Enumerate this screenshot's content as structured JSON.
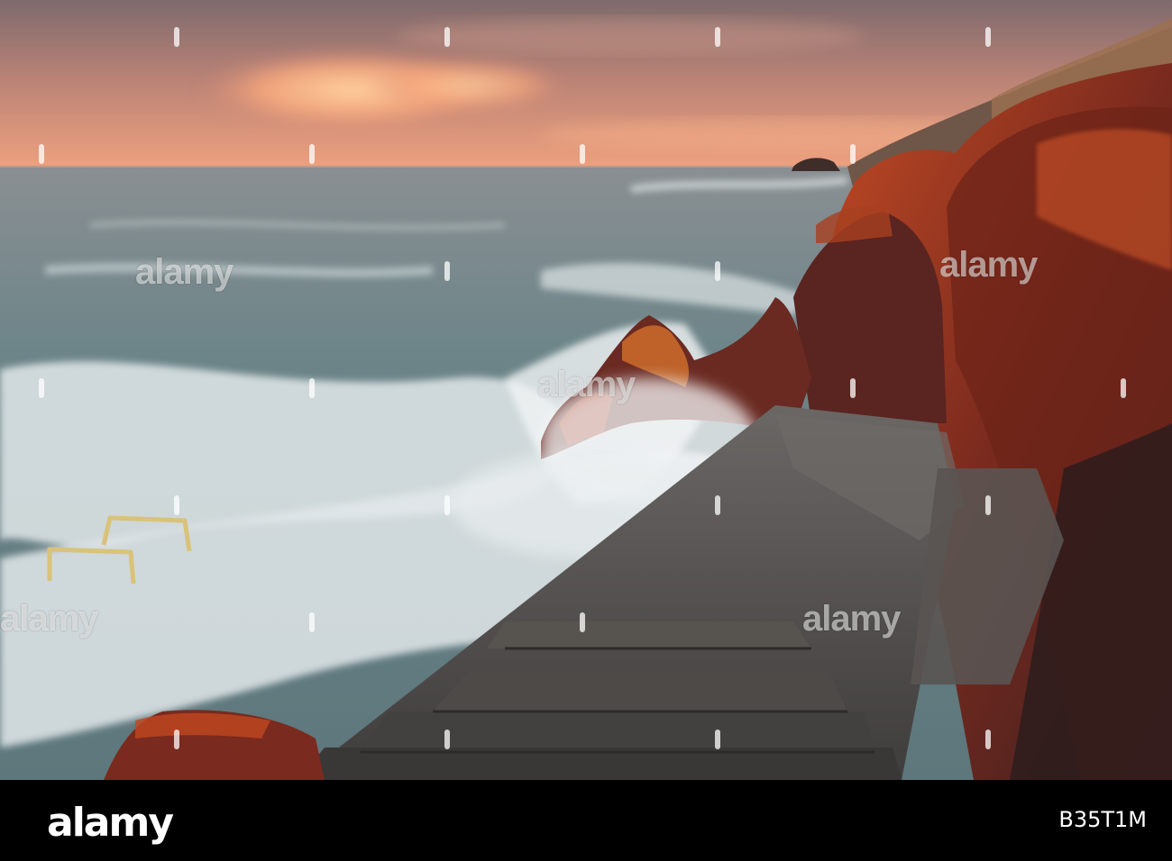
{
  "photo": {
    "description_colors": {
      "sky_top": "#8a7170",
      "sky_glow": "#f3a277",
      "cloud": "#ffc591",
      "sea": "#5f7b80",
      "foam": "#e6ebee",
      "rock_lit": "#b63d1c",
      "rock_dark": "#3a2222",
      "steps": "#54514f"
    }
  },
  "watermark": {
    "text": "alamy"
  },
  "stock_bar": {
    "logo_text": "alamy",
    "image_id": "B35T1M"
  }
}
